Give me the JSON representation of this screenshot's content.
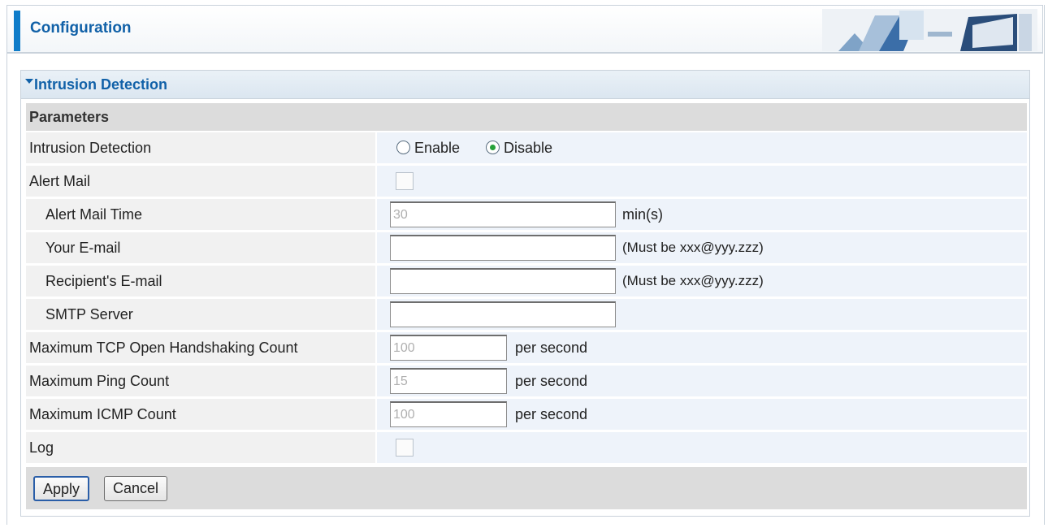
{
  "header": {
    "title": "Configuration"
  },
  "section": {
    "title": "Intrusion Detection",
    "params_label": "Parameters"
  },
  "rows": {
    "intrusion": {
      "label": "Intrusion Detection",
      "enable": "Enable",
      "disable": "Disable",
      "selected": "Disable"
    },
    "alert_mail": {
      "label": "Alert Mail",
      "checked": false
    },
    "alert_mail_time": {
      "label": "Alert Mail Time",
      "value": "30",
      "unit": "min(s)"
    },
    "your_email": {
      "label": "Your E-mail",
      "value": "",
      "hint": "(Must be xxx@yyy.zzz)"
    },
    "recipient_email": {
      "label": "Recipient's E-mail",
      "value": "",
      "hint": "(Must be xxx@yyy.zzz)"
    },
    "smtp": {
      "label": "SMTP Server",
      "value": ""
    },
    "tcp": {
      "label": "Maximum TCP Open Handshaking Count",
      "value": "100",
      "unit": "per second"
    },
    "ping": {
      "label": "Maximum Ping Count",
      "value": "15",
      "unit": "per second"
    },
    "icmp": {
      "label": "Maximum ICMP Count",
      "value": "100",
      "unit": "per second"
    },
    "log": {
      "label": "Log",
      "checked": false
    }
  },
  "buttons": {
    "apply": "Apply",
    "cancel": "Cancel"
  },
  "colors": {
    "accent": "#0f7cc9",
    "title_blue": "#1161a8",
    "radio_selected": "#27a13a"
  },
  "icons": {
    "collapse": "triangle-down-icon",
    "header_art": "office-chairs-illustration"
  }
}
